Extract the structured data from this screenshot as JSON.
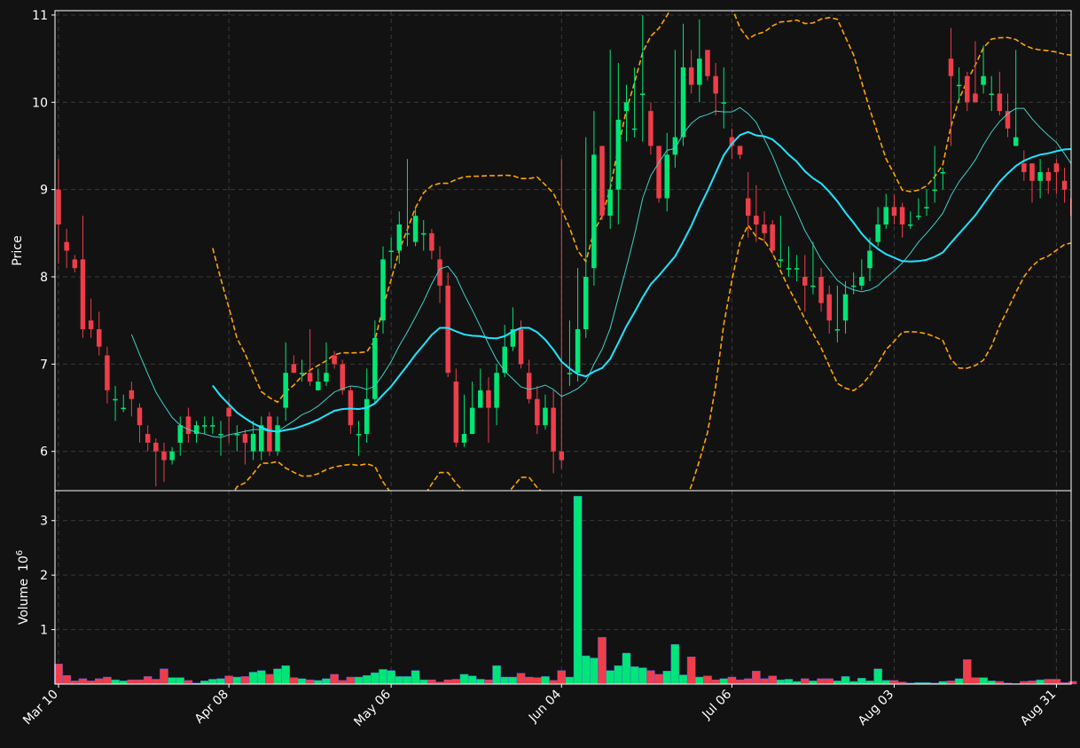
{
  "chart_data": {
    "type": "candlestick",
    "price_axis": {
      "label": "Price",
      "ylim": [
        5.55,
        11.05
      ],
      "ticks": [
        "6",
        "7",
        "8",
        "9",
        "10",
        "11"
      ]
    },
    "volume_axis": {
      "label": "Volume",
      "exponent_label": "10",
      "exponent_power": "6",
      "ylim": [
        0,
        3.5
      ],
      "ticks": [
        "1",
        "2",
        "3"
      ]
    },
    "x_tick_labels": [
      {
        "label": "Mar 10",
        "index": 0
      },
      {
        "label": "Apr 08",
        "index": 21
      },
      {
        "label": "May 06",
        "index": 41
      },
      {
        "label": "Jun 04",
        "index": 62
      },
      {
        "label": "Jul 06",
        "index": 83
      },
      {
        "label": "Aug 03",
        "index": 103
      },
      {
        "label": "Aug 31",
        "index": 123
      }
    ],
    "colors": {
      "up": "#00e676",
      "down": "#ef3e4a",
      "ma_fast": "#3fd0c9",
      "ma_slow": "#22e4ff",
      "bands": "#ffa500",
      "grid": "#3a3a3a",
      "axes": "#ffffff",
      "background": "#121212"
    },
    "close": [
      8.6,
      8.3,
      8.1,
      7.4,
      7.4,
      7.2,
      6.7,
      6.6,
      6.5,
      6.6,
      6.3,
      6.1,
      6.0,
      5.9,
      6.0,
      6.3,
      6.2,
      6.3,
      6.3,
      6.3,
      6.2,
      6.4,
      6.2,
      6.1,
      6.2,
      6.3,
      6.0,
      6.3,
      6.9,
      6.9,
      6.9,
      6.8,
      6.8,
      6.9,
      7.0,
      6.7,
      6.3,
      6.2,
      6.6,
      7.3,
      8.2,
      8.3,
      8.6,
      8.5,
      8.7,
      8.5,
      8.3,
      7.9,
      6.9,
      6.1,
      6.2,
      6.5,
      6.7,
      6.5,
      6.9,
      7.2,
      7.4,
      7.0,
      6.6,
      6.3,
      6.5,
      6.0,
      5.9,
      6.9,
      7.4,
      8.0,
      9.4,
      8.7,
      9.0,
      9.8,
      10.0,
      9.7,
      10.1,
      9.5,
      8.9,
      9.4,
      9.6,
      10.4,
      10.2,
      10.5,
      10.3,
      10.1,
      10.0,
      9.5,
      9.4,
      8.7,
      8.6,
      8.5,
      8.3,
      8.2,
      8.1,
      8.1,
      7.9,
      7.9,
      7.7,
      7.5,
      7.4,
      7.8,
      7.9,
      8.0,
      8.3,
      8.6,
      8.8,
      8.7,
      8.6,
      8.6,
      8.7,
      8.8,
      9.0,
      9.2,
      10.3,
      10.2,
      10.0,
      10.0,
      10.3,
      10.1,
      9.9,
      9.7,
      9.6,
      9.2,
      9.1,
      9.2,
      9.1,
      9.2,
      9.0,
      8.7
    ],
    "open": [
      9.0,
      8.4,
      8.2,
      8.2,
      7.5,
      7.4,
      7.1,
      6.6,
      6.5,
      6.7,
      6.5,
      6.2,
      6.1,
      6.0,
      5.9,
      6.1,
      6.4,
      6.2,
      6.3,
      6.3,
      6.2,
      6.5,
      6.2,
      6.2,
      6.0,
      6.0,
      6.4,
      6.0,
      6.5,
      7.0,
      6.9,
      6.9,
      6.7,
      6.8,
      7.1,
      7.0,
      6.7,
      6.2,
      6.2,
      6.6,
      7.5,
      8.3,
      8.3,
      8.5,
      8.4,
      8.5,
      8.5,
      8.2,
      7.9,
      6.8,
      6.1,
      6.2,
      6.5,
      6.7,
      6.5,
      6.9,
      7.2,
      7.4,
      6.9,
      6.6,
      6.3,
      6.5,
      6.0,
      6.9,
      6.9,
      7.4,
      8.1,
      9.5,
      8.7,
      9.0,
      9.9,
      9.7,
      10.1,
      9.9,
      9.5,
      8.9,
      9.4,
      9.6,
      10.4,
      10.2,
      10.6,
      10.3,
      10.0,
      9.6,
      9.5,
      8.9,
      8.7,
      8.6,
      8.6,
      8.2,
      8.1,
      8.1,
      8.0,
      7.9,
      8.0,
      7.8,
      7.4,
      7.5,
      7.9,
      7.9,
      8.1,
      8.4,
      8.6,
      8.8,
      8.8,
      8.6,
      8.7,
      8.8,
      9.0,
      9.2,
      10.5,
      10.2,
      10.3,
      10.1,
      10.2,
      10.1,
      10.1,
      9.9,
      9.5,
      9.3,
      9.3,
      9.1,
      9.2,
      9.3,
      9.1,
      8.9
    ],
    "high": [
      9.35,
      8.55,
      8.25,
      8.7,
      7.75,
      7.6,
      7.2,
      6.75,
      6.65,
      6.8,
      6.55,
      6.3,
      6.15,
      6.1,
      6.05,
      6.4,
      6.5,
      6.35,
      6.4,
      6.4,
      6.35,
      6.6,
      6.3,
      6.25,
      6.35,
      6.4,
      6.45,
      6.4,
      7.25,
      7.1,
      7.05,
      7.4,
      6.95,
      7.25,
      7.15,
      7.05,
      6.75,
      6.35,
      6.95,
      7.5,
      8.35,
      8.45,
      8.75,
      9.35,
      8.8,
      8.65,
      8.55,
      8.35,
      8.05,
      6.95,
      6.65,
      6.8,
      6.95,
      6.85,
      7.0,
      7.45,
      7.65,
      7.5,
      7.05,
      6.75,
      6.65,
      6.7,
      9.35,
      7.5,
      8.1,
      9.6,
      9.9,
      9.0,
      10.6,
      10.45,
      10.2,
      10.4,
      11.0,
      10.0,
      9.5,
      9.65,
      10.6,
      10.9,
      10.6,
      10.95,
      10.55,
      10.45,
      10.4,
      9.7,
      9.5,
      9.2,
      9.05,
      8.75,
      8.65,
      8.7,
      8.35,
      8.25,
      8.25,
      8.4,
      8.1,
      7.9,
      7.9,
      7.95,
      8.05,
      8.2,
      8.45,
      8.8,
      8.95,
      8.95,
      8.85,
      8.75,
      8.9,
      9.0,
      9.5,
      9.25,
      10.85,
      10.4,
      10.35,
      10.7,
      10.65,
      10.3,
      10.35,
      10.1,
      10.6,
      9.45,
      9.3,
      9.35,
      9.25,
      9.35,
      9.25,
      9.0
    ],
    "low": [
      8.15,
      8.1,
      8.05,
      7.3,
      7.3,
      7.1,
      6.55,
      6.35,
      6.45,
      6.4,
      6.1,
      6.0,
      5.6,
      5.65,
      5.85,
      5.95,
      6.1,
      6.1,
      6.2,
      6.2,
      5.95,
      6.1,
      6.0,
      5.85,
      5.9,
      5.9,
      5.95,
      5.95,
      6.35,
      6.9,
      6.8,
      6.75,
      6.7,
      6.75,
      6.95,
      6.65,
      6.2,
      5.95,
      6.1,
      6.55,
      7.35,
      8.1,
      8.15,
      8.35,
      8.35,
      8.3,
      8.2,
      7.7,
      6.85,
      6.05,
      6.05,
      6.4,
      6.5,
      6.1,
      6.3,
      6.85,
      7.15,
      6.95,
      6.55,
      6.2,
      6.25,
      5.75,
      5.8,
      6.75,
      6.8,
      7.3,
      7.9,
      8.65,
      8.55,
      8.6,
      9.55,
      9.6,
      9.55,
      9.4,
      8.85,
      8.75,
      9.25,
      9.5,
      10.1,
      10.0,
      10.25,
      9.85,
      9.7,
      9.35,
      9.35,
      8.45,
      8.4,
      8.4,
      8.25,
      8.1,
      8.0,
      7.95,
      7.6,
      7.8,
      7.6,
      7.35,
      7.25,
      7.35,
      7.8,
      7.85,
      7.95,
      8.35,
      8.55,
      8.6,
      8.45,
      8.55,
      8.65,
      8.7,
      8.85,
      9.0,
      9.5,
      10.0,
      9.9,
      10.0,
      10.1,
      9.9,
      9.85,
      9.6,
      9.5,
      9.1,
      8.85,
      8.9,
      8.95,
      8.95,
      8.85,
      8.6
    ],
    "volume": [
      0.37,
      0.16,
      0.06,
      0.1,
      0.06,
      0.1,
      0.13,
      0.08,
      0.06,
      0.08,
      0.08,
      0.14,
      0.09,
      0.28,
      0.12,
      0.12,
      0.07,
      0.02,
      0.06,
      0.09,
      0.1,
      0.15,
      0.13,
      0.14,
      0.22,
      0.25,
      0.18,
      0.28,
      0.34,
      0.12,
      0.1,
      0.08,
      0.07,
      0.1,
      0.18,
      0.07,
      0.13,
      0.13,
      0.16,
      0.21,
      0.27,
      0.25,
      0.14,
      0.14,
      0.25,
      0.08,
      0.08,
      0.04,
      0.08,
      0.09,
      0.18,
      0.15,
      0.09,
      0.08,
      0.34,
      0.13,
      0.13,
      0.2,
      0.13,
      0.12,
      0.14,
      0.07,
      0.25,
      0.13,
      3.45,
      0.52,
      0.48,
      0.86,
      0.25,
      0.34,
      0.57,
      0.32,
      0.3,
      0.25,
      0.18,
      0.24,
      0.73,
      0.17,
      0.5,
      0.13,
      0.15,
      0.08,
      0.1,
      0.13,
      0.08,
      0.1,
      0.24,
      0.1,
      0.15,
      0.08,
      0.09,
      0.05,
      0.1,
      0.06,
      0.1,
      0.1,
      0.06,
      0.14,
      0.05,
      0.11,
      0.06,
      0.28,
      0.07,
      0.07,
      0.04,
      0.02,
      0.03,
      0.03,
      0.02,
      0.05,
      0.06,
      0.1,
      0.45,
      0.12,
      0.12,
      0.06,
      0.05,
      0.02,
      0.01,
      0.05,
      0.06,
      0.08,
      0.09,
      0.09,
      0.03,
      0.05,
      0.05
    ]
  }
}
